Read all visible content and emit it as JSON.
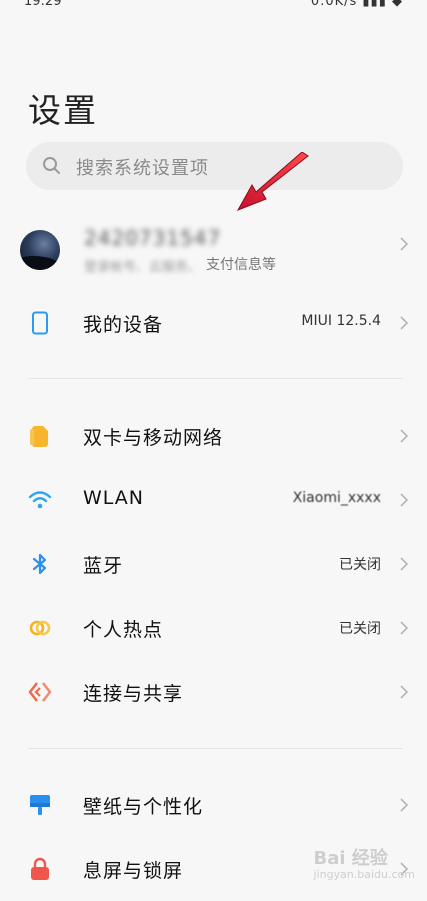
{
  "status": {
    "time": "19:29",
    "right": "0.0K/s ▮▮▮ ◆"
  },
  "page_title": "设置",
  "search": {
    "placeholder": "搜索系统设置项"
  },
  "account": {
    "name": "2420731547",
    "sub_blurred": "登录帐号、云服务、",
    "sub": "支付信息等"
  },
  "my_device": {
    "label": "我的设备",
    "value": "MIUI 12.5.4"
  },
  "network": {
    "items": [
      {
        "label": "双卡与移动网络",
        "value": "",
        "icon": "sim-card-icon",
        "color": "#f6b52c"
      },
      {
        "label": "WLAN",
        "value": "Xiaomi_xxxx",
        "icon": "wifi-icon",
        "color": "#2ba7f0"
      },
      {
        "label": "蓝牙",
        "value": "已关闭",
        "icon": "bluetooth-icon",
        "color": "#2a90f0"
      },
      {
        "label": "个人热点",
        "value": "已关闭",
        "icon": "hotspot-icon",
        "color": "#f2b31f"
      },
      {
        "label": "连接与共享",
        "value": "",
        "icon": "share-icon",
        "color": "#f06a4c"
      }
    ]
  },
  "personal": {
    "items": [
      {
        "label": "壁纸与个性化",
        "icon": "wallpaper-icon",
        "color": "#2b8ff0"
      },
      {
        "label": "息屏与锁屏",
        "icon": "lock-icon",
        "color": "#f0564c"
      }
    ]
  },
  "watermark": {
    "main": "Bai 经验",
    "sub": "jingyan.baidu.com"
  }
}
